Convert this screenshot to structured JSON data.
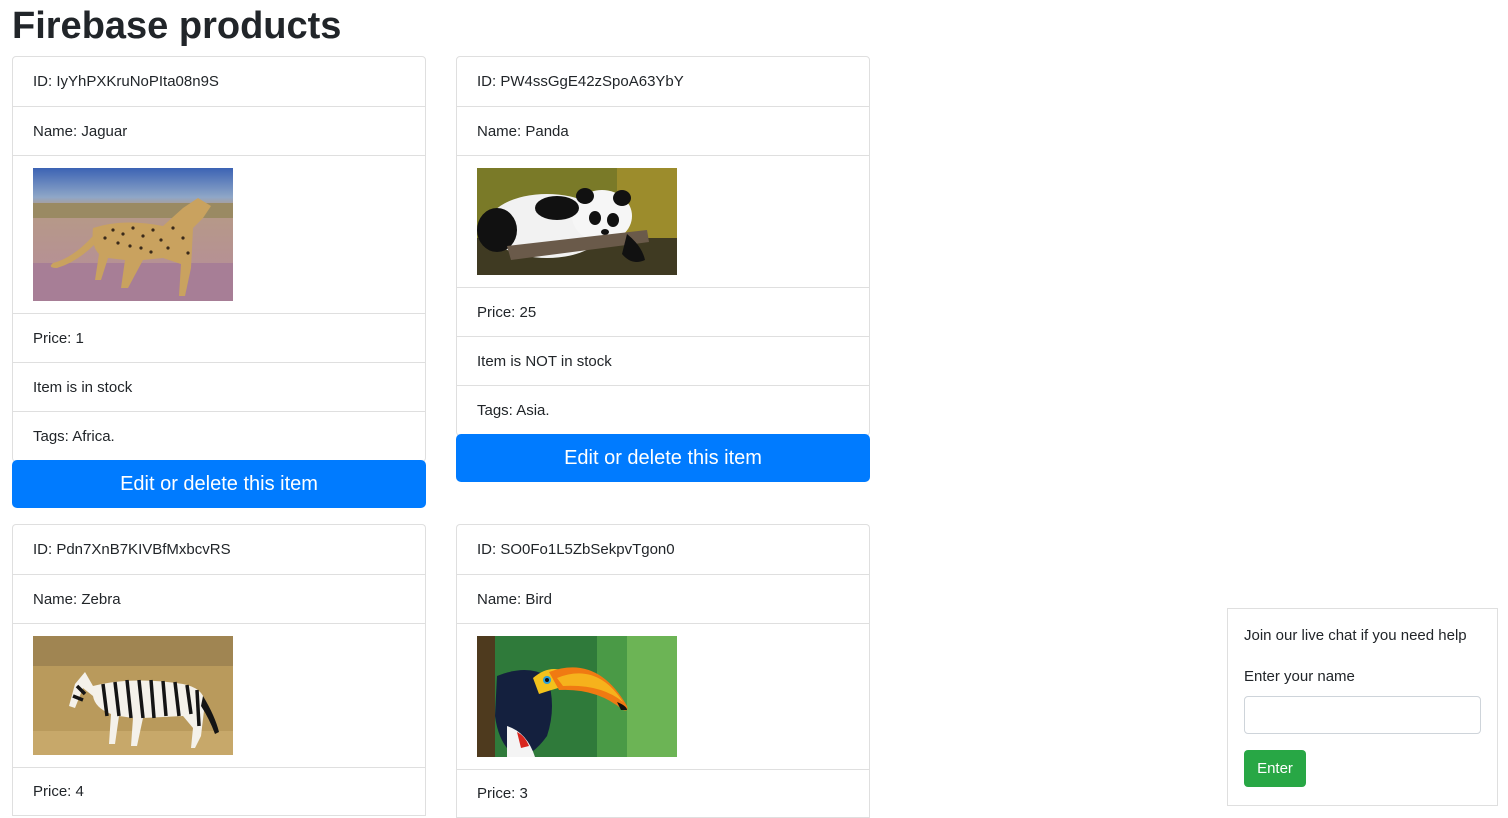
{
  "page": {
    "title": "Firebase products"
  },
  "products": [
    {
      "id": "ID: IyYhPXKruNoPIta08n9S",
      "name": "Name: Jaguar",
      "image": "cheetah-photo",
      "price": "Price: 1",
      "stock": "Item is in stock",
      "tags": "Tags: Africa.",
      "action": "Edit or delete this item"
    },
    {
      "id": "ID: PW4ssGgE42zSpoA63YbY",
      "name": "Name: Panda",
      "image": "panda-photo",
      "price": "Price: 25",
      "stock": "Item is NOT in stock",
      "tags": "Tags: Asia.",
      "action": "Edit or delete this item"
    },
    {
      "id": "ID: Pdn7XnB7KIVBfMxbcvRS",
      "name": "Name: Zebra",
      "image": "zebra-photo",
      "price": "Price: 4"
    },
    {
      "id": "ID: SO0Fo1L5ZbSekpvTgon0",
      "name": "Name: Bird",
      "image": "toucan-photo",
      "price": "Price: 3"
    }
  ],
  "chat": {
    "intro": "Join our live chat if you need help",
    "name_label": "Enter your name",
    "name_value": "",
    "enter_label": "Enter"
  }
}
